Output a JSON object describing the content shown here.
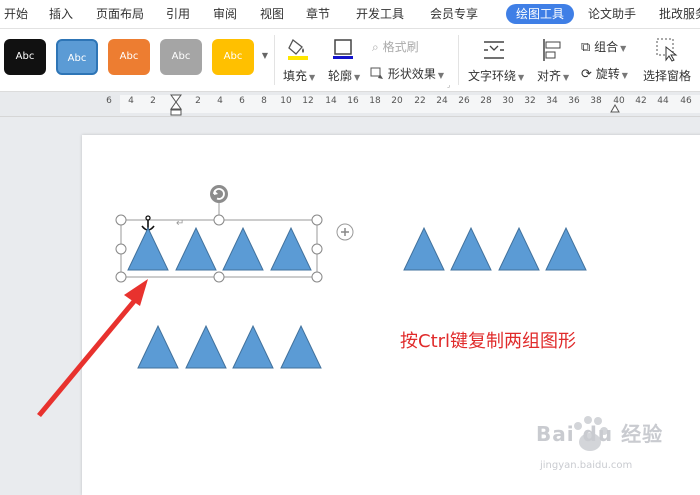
{
  "menu": {
    "tabs": [
      {
        "label": "开始",
        "active": false
      },
      {
        "label": "插入",
        "active": false
      },
      {
        "label": "页面布局",
        "active": false
      },
      {
        "label": "引用",
        "active": false
      },
      {
        "label": "审阅",
        "active": false
      },
      {
        "label": "视图",
        "active": false
      },
      {
        "label": "章节",
        "active": false
      },
      {
        "label": "开发工具",
        "active": false
      },
      {
        "label": "会员专享",
        "active": false
      },
      {
        "label": "绘图工具",
        "active": true
      },
      {
        "label": "论文助手",
        "active": false
      },
      {
        "label": "批改服务",
        "active": false
      }
    ]
  },
  "ribbon": {
    "styles": [
      {
        "label": "Abc",
        "fill": "#111111"
      },
      {
        "label": "Abc",
        "fill": "#5b9bd5"
      },
      {
        "label": "Abc",
        "fill": "#ed7d31"
      },
      {
        "label": "Abc",
        "fill": "#a5a5a5"
      },
      {
        "label": "Abc",
        "fill": "#ffc000"
      }
    ],
    "fill_label": "填充",
    "outline_label": "轮廓",
    "format_painter_label": "格式刷",
    "shape_effects_label": "形状效果",
    "wrap_text_label": "文字环绕",
    "align_label": "对齐",
    "group_label": "组合",
    "rotate_label": "旋转",
    "selection_pane_label": "选择窗格"
  },
  "ruler": {
    "ticks": [
      "6",
      "4",
      "2",
      "",
      "2",
      "4",
      "6",
      "8",
      "10",
      "12",
      "14",
      "16",
      "18",
      "20",
      "22",
      "24",
      "26",
      "28",
      "30",
      "32",
      "34",
      "36",
      "38",
      "40",
      "42",
      "44",
      "46"
    ]
  },
  "document": {
    "annotation": "按Ctrl键复制两组图形",
    "triangle_fill": "#5b9bd5",
    "triangle_stroke": "#41719c",
    "arrow_color": "#e8322e"
  },
  "watermark": {
    "main": "Bai du 经验",
    "sub": "jingyan.baidu.com"
  }
}
